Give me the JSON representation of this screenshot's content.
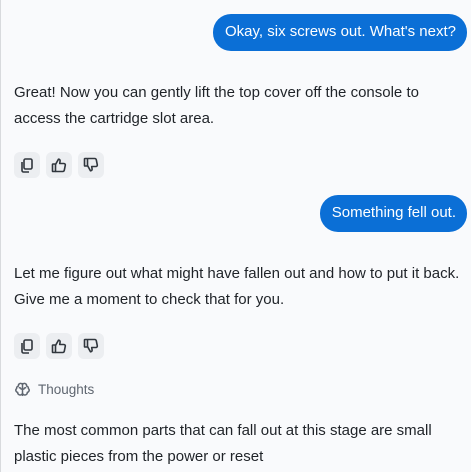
{
  "messages": [
    {
      "role": "user",
      "text": "Okay, six screws out. What's next?"
    },
    {
      "role": "assistant",
      "text": "Great! Now you can gently lift the top cover off the console to access the cartridge slot area."
    },
    {
      "role": "user",
      "text": "Something fell out."
    },
    {
      "role": "assistant",
      "text": "Let me figure out what might have fallen out and how to put it back. Give me a moment to check that for you."
    }
  ],
  "thoughts": {
    "label": "Thoughts",
    "icon": "brain-icon"
  },
  "streaming_text": "The most common parts that can fall out at this stage are small plastic pieces from the power or reset",
  "action_icons": [
    "copy-icon",
    "thumbs-up-icon",
    "thumbs-down-icon"
  ],
  "colors": {
    "user_bubble": "#0b6fd6",
    "background": "#f9fafc",
    "action_button": "#eceef1"
  }
}
